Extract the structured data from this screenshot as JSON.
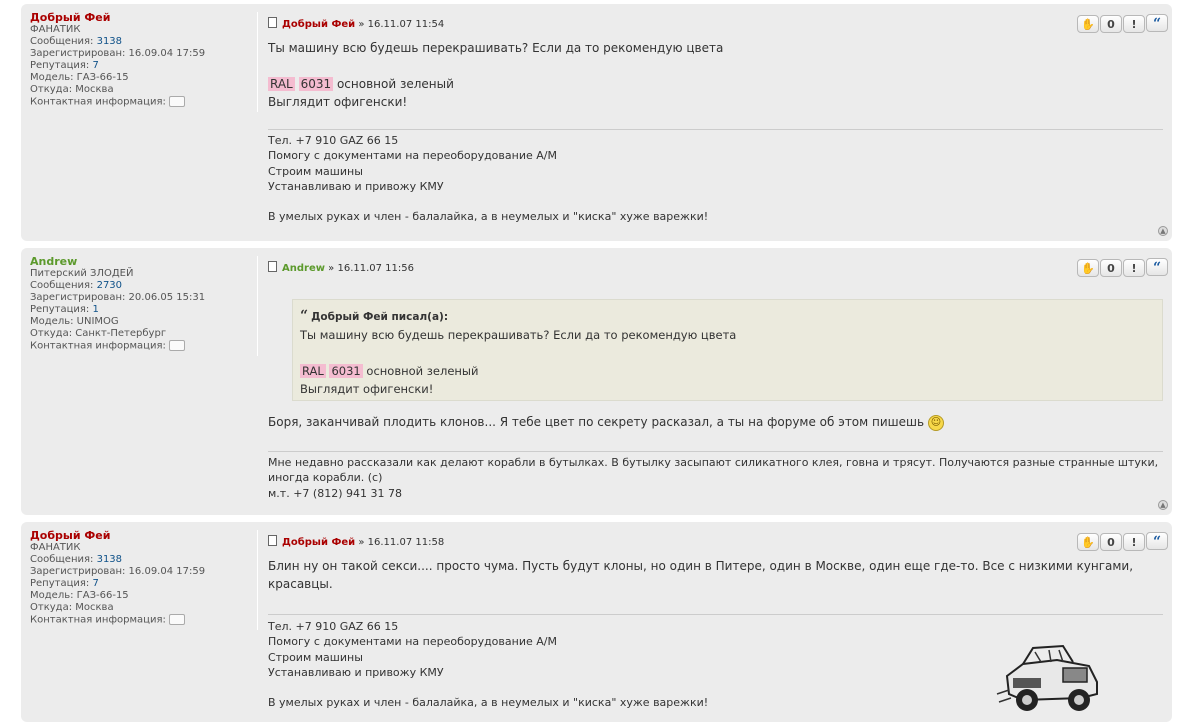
{
  "posts": [
    {
      "user": {
        "name": "Добрый Фей",
        "rank": "ФАНАТИК",
        "name_color": "#aa0000",
        "fields": [
          {
            "label": "Сообщения:",
            "value": "3138",
            "link": true
          },
          {
            "label": "Зарегистрирован:",
            "value": "16.09.04 17:59"
          },
          {
            "label": "Репутация:",
            "value": "7",
            "link": true
          },
          {
            "label": "Модель:",
            "value": "ГАЗ-66-15"
          },
          {
            "label": "Откуда:",
            "value": "Москва"
          }
        ],
        "contact_label": "Контактная информация:"
      },
      "author": "Добрый Фей",
      "sep": "»",
      "date": "16.11.07 11:54",
      "text_line1": "Ты машину всю будешь перекрашивать? Если да то рекомендую цвета",
      "ral": "RAL",
      "ral_num": "6031",
      "color_desc": "основной зеленый",
      "text_line4": "Выглядит офигенски!",
      "sig": [
        "Тел. +7 910 GAZ 66 15",
        "Помогу с документами на переоборудование А/М",
        "Строим машины",
        "Устанавливаю и привожу КМУ",
        "",
        "В умелых руках и член - балалайка, а в неумелых и \"киска\" хуже варежки!"
      ]
    },
    {
      "user": {
        "name": "Andrew",
        "rank": "Питерский ЗЛОДЕЙ",
        "name_color": "#5c9a2c",
        "fields": [
          {
            "label": "Сообщения:",
            "value": "2730",
            "link": true
          },
          {
            "label": "Зарегистрирован:",
            "value": "20.06.05 15:31"
          },
          {
            "label": "Репутация:",
            "value": "1",
            "link": true
          },
          {
            "label": "Модель:",
            "value": "UNIMOG"
          },
          {
            "label": "Откуда:",
            "value": "Санкт-Петербург"
          }
        ],
        "contact_label": "Контактная информация:"
      },
      "author": "Andrew",
      "sep": "»",
      "date": "16.11.07 11:56",
      "quote": {
        "cite": "Добрый Фей писал(а):",
        "line1": "Ты машину всю будешь перекрашивать? Если да то рекомендую цвета",
        "ral": "RAL",
        "ral_num": "6031",
        "color_desc": "основной зеленый",
        "line4": "Выглядит офигенски!"
      },
      "text": "Боря, заканчивай плодить клонов... Я тебе цвет по секрету расказал, а ты на форуме об этом пишешь",
      "sig": [
        "Мне недавно рассказали как делают корабли в бутылках. В бутылку засыпают силикатного клея, говна и трясут. Получаются разные странные штуки,",
        "иногда корабли. (с)",
        "м.т. +7 (812) 941 31 78"
      ]
    },
    {
      "user": {
        "name": "Добрый Фей",
        "rank": "ФАНАТИК",
        "name_color": "#aa0000",
        "fields": [
          {
            "label": "Сообщения:",
            "value": "3138",
            "link": true
          },
          {
            "label": "Зарегистрирован:",
            "value": "16.09.04 17:59"
          },
          {
            "label": "Репутация:",
            "value": "7",
            "link": true
          },
          {
            "label": "Модель:",
            "value": "ГАЗ-66-15"
          },
          {
            "label": "Откуда:",
            "value": "Москва"
          }
        ],
        "contact_label": "Контактная информация:"
      },
      "author": "Добрый Фей",
      "sep": "»",
      "date": "16.11.07 11:58",
      "text": "Блин ну он такой секси.... просто чума. Пусть будут клоны, но один в Питере, один в Москве, один еще где-то. Все с низкими кунгами, красавцы.",
      "sig": [
        "Тел. +7 910 GAZ 66 15",
        "Помогу с документами на переоборудование А/М",
        "Строим машины",
        "Устанавливаю и привожу КМУ",
        "",
        "В умелых руках и член - балалайка, а в неумелых и \"киска\" хуже варежки!"
      ]
    }
  ],
  "buttons": {
    "like": "👍",
    "rep": "0",
    "report": "!",
    "quote": "“"
  },
  "icons": {
    "post": "post-icon",
    "top": "back-to-top-icon",
    "contact": "speech-bubble-icon",
    "smiley": "smiley-icon"
  }
}
